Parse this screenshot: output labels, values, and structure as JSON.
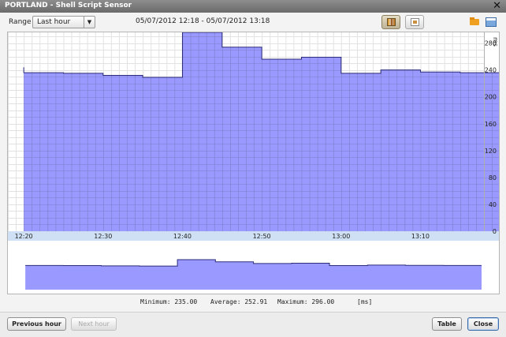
{
  "window": {
    "title": "PORTLAND - Shell Script Sensor"
  },
  "toolbar": {
    "range_label": "Range",
    "range_value": "Last hour",
    "date_range": "05/07/2012 12:18 - 05/07/2012 13:18"
  },
  "colors": {
    "fill": "#9999ff",
    "line": "#2c2c7a",
    "grid": "#7e7ec8",
    "axis_band": "#cfe0f5"
  },
  "chart_data": {
    "type": "area",
    "ylabel": "ms",
    "ylim": [
      0,
      296
    ],
    "yticks": [
      "0",
      "40",
      "80",
      "120",
      "160",
      "200",
      "240",
      "280"
    ],
    "ytick_values": [
      0,
      40,
      80,
      120,
      160,
      200,
      240,
      280
    ],
    "xticks": [
      "12:20",
      "12:30",
      "12:40",
      "12:50",
      "13:00",
      "13:10"
    ],
    "xtick_values": [
      20,
      30,
      40,
      50,
      60,
      70
    ],
    "xlim": [
      18,
      78
    ],
    "series": [
      {
        "x": [
          20,
          25,
          30,
          35,
          40,
          45,
          50,
          55,
          60,
          65,
          70,
          75
        ],
        "values": [
          236,
          235,
          232,
          229,
          296,
          274,
          256,
          259,
          235,
          240,
          237,
          236
        ]
      }
    ],
    "start_spike": 244
  },
  "stats": {
    "minimum": "Minimum: 235.00",
    "average": "Average: 252.91",
    "maximum": "Maximum: 296.00",
    "unit": "[ms]"
  },
  "buttons": {
    "previous_hour": "Previous hour",
    "next_hour": "Next hour",
    "table": "Table",
    "close": "Close"
  }
}
